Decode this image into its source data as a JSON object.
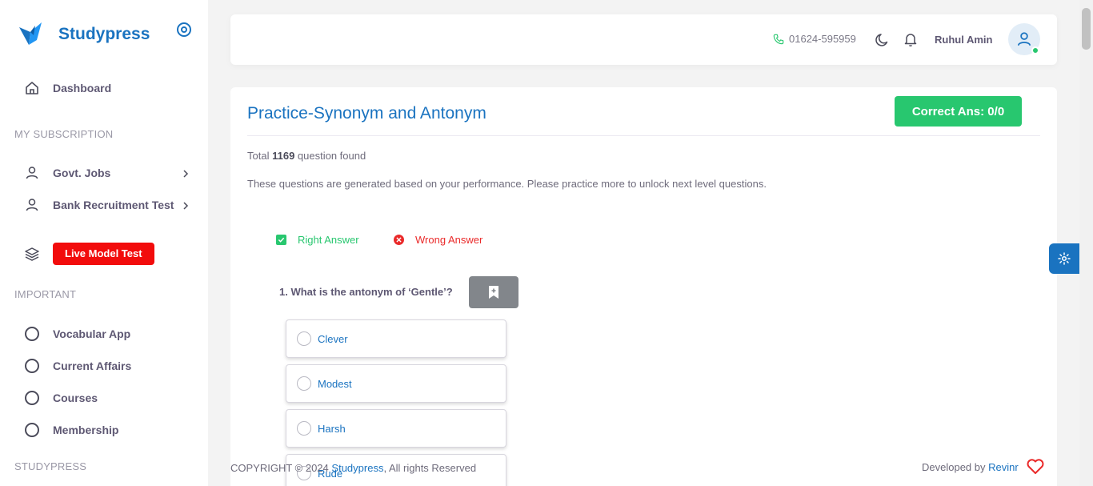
{
  "sidebar": {
    "brand": "Studypress",
    "items": {
      "dashboard": "Dashboard",
      "govt_jobs": "Govt. Jobs",
      "bank_test": "Bank Recruitment Test",
      "live_model_test": "Live Model Test",
      "vocabular_app": "Vocabular App",
      "current_affairs": "Current Affairs",
      "courses": "Courses",
      "membership": "Membership"
    },
    "sections": {
      "subscription": "MY SUBSCRIPTION",
      "important": "IMPORTANT",
      "studypress": "STUDYPRESS"
    }
  },
  "header": {
    "phone": "01624-595959",
    "user_name": "Ruhul Amin"
  },
  "main": {
    "title": "Practice-Synonym and Antonym",
    "correct_ans": "Correct Ans: 0/0",
    "total_prefix": "Total",
    "total_count": "1169",
    "total_suffix": "question found",
    "description": "These questions are generated based on your performance. Please practice more to unlock next level questions.",
    "legend": {
      "right": "Right Answer",
      "wrong": "Wrong Answer"
    },
    "question": {
      "text": "1. What is the antonym of ‘Gentle’?",
      "options": [
        "Clever",
        "Modest",
        "Harsh",
        "Rude"
      ]
    }
  },
  "footer": {
    "copyright_prefix": "COPYRIGHT © 2024",
    "copyright_link": "Studypress",
    "copyright_suffix": ", All rights Reserved",
    "developed_by": "Developed by",
    "developer": "Revinr"
  },
  "colors": {
    "brand_blue": "#1a73c0",
    "success_green": "#28c76f",
    "danger_red": "#f20c0c"
  }
}
